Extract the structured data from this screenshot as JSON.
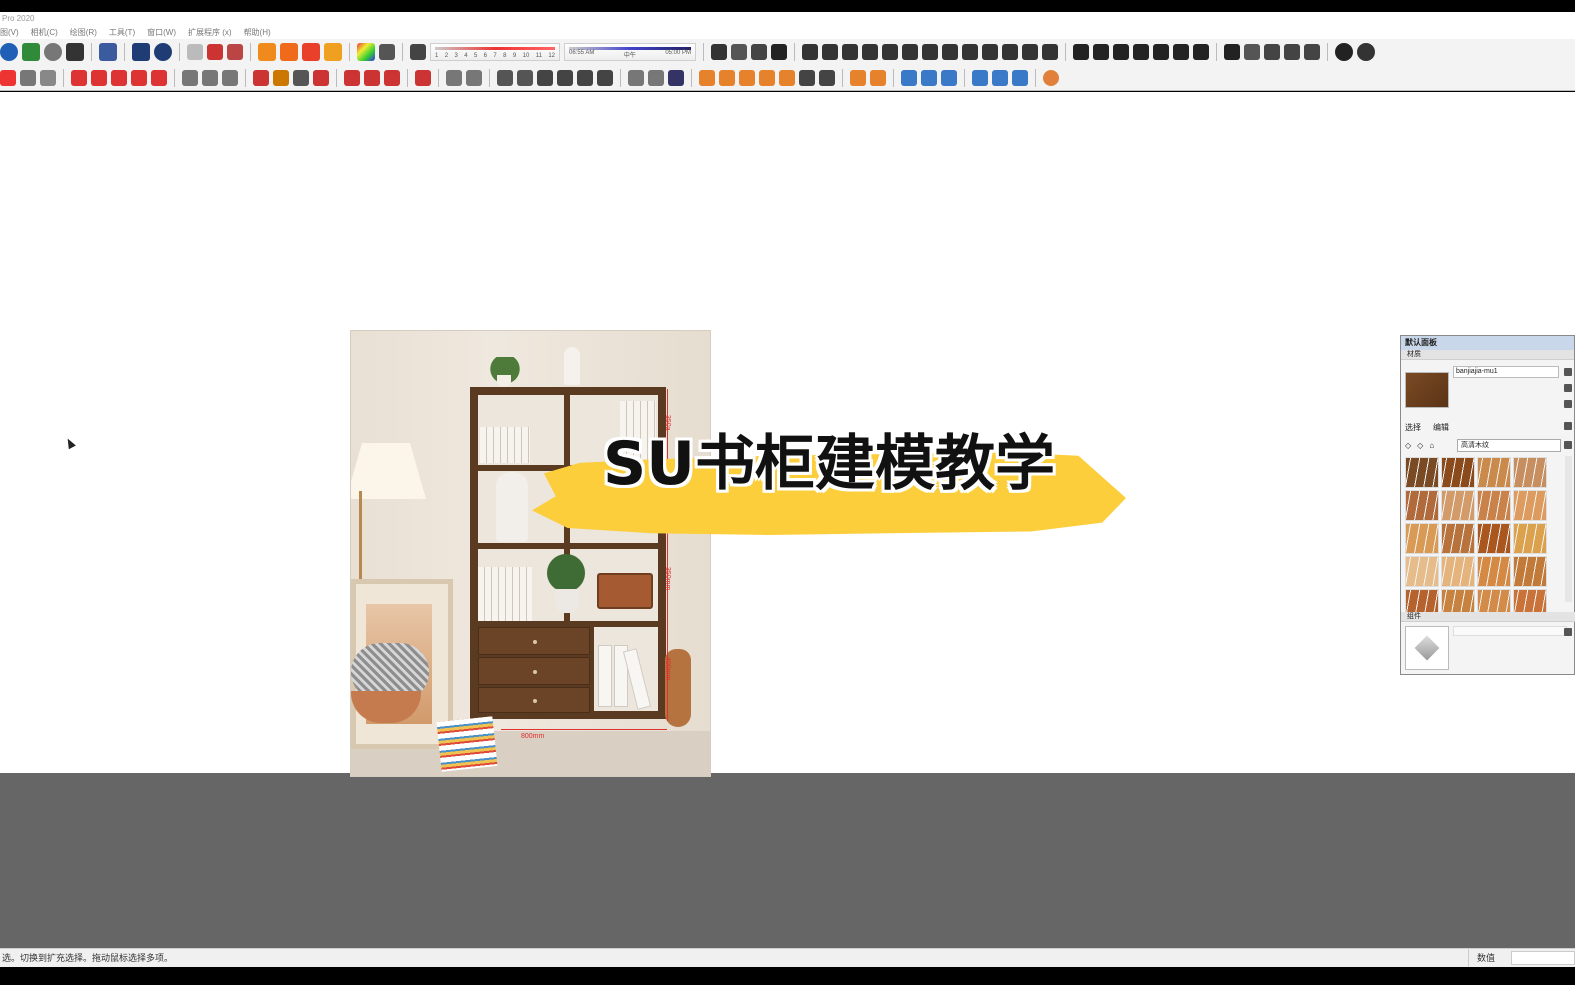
{
  "app": {
    "title": "Pro 2020"
  },
  "menu": {
    "items": [
      "图(V)",
      "相机(C)",
      "绘图(R)",
      "工具(T)",
      "窗口(W)",
      "扩展程序 (x)",
      "帮助(H)"
    ]
  },
  "toolbar": {
    "shadow_slider_labels": [
      "1",
      "2",
      "3",
      "4",
      "5",
      "6",
      "7",
      "8",
      "9",
      "10",
      "11",
      "12"
    ],
    "time_start": "06:55 AM",
    "time_mid": "中午",
    "time_end": "05:00 PM"
  },
  "canvas": {
    "banner_title": "SU书柜建模教学",
    "photo_dimensions": [
      "350a",
      "350mm",
      "400mm",
      "800mm"
    ]
  },
  "panel": {
    "title": "默认面板",
    "materials_section": "材质",
    "material_name": "banjiajia-mu1",
    "tab_select": "选择",
    "tab_edit": "编辑",
    "library_name": "高清木纹",
    "components_section": "组件",
    "swatch_colors": [
      "#7a4a24",
      "#8b4a1c",
      "#c98a4b",
      "#c78e5f",
      "#b06a3b",
      "#d39a6a",
      "#c9834a",
      "#dd9b5f",
      "#d99a55",
      "#b8733d",
      "#a9571f",
      "#dca14d",
      "#e6bd8a",
      "#e5b47c",
      "#d48a45",
      "#c27a38",
      "#b5622e",
      "#c8823f",
      "#d28b49",
      "#c9733a"
    ]
  },
  "status": {
    "message": "选。切换到扩充选择。拖动鼠标选择多项。",
    "value_label": "数值",
    "value": ""
  },
  "colors": {
    "banner_yellow": "#fcce3b",
    "ground": "#666666",
    "viewport": "#ffffff"
  }
}
